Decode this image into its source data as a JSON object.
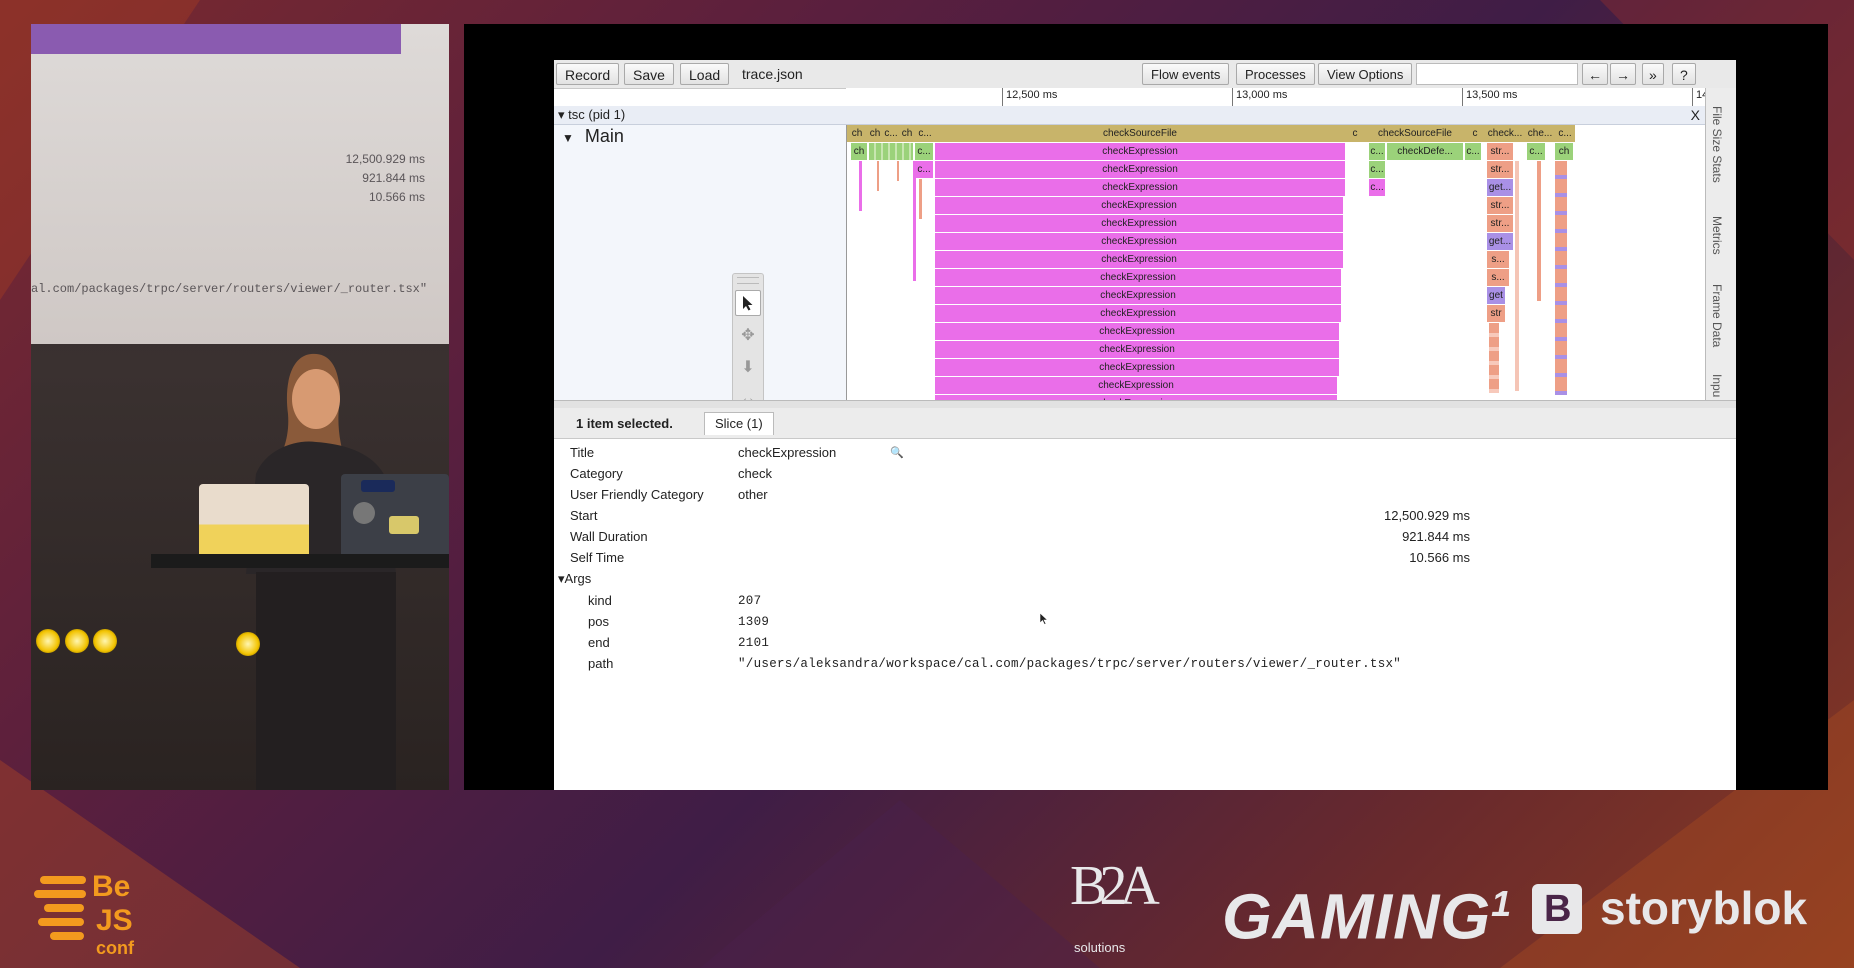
{
  "projection": {
    "values": [
      "12,500.929 ms",
      "921.844 ms",
      "10.566 ms"
    ],
    "path_fragment": "al.com/packages/trpc/server/routers/viewer/_router.tsx\""
  },
  "toolbar": {
    "record": "Record",
    "save": "Save",
    "load": "Load",
    "filename": "trace.json",
    "flow_events": "Flow events",
    "processes": "Processes",
    "view_options": "View Options",
    "prev": "←",
    "next": "→",
    "more": "»",
    "help": "?"
  },
  "ruler": {
    "ticks": [
      "12,500 ms",
      "13,000 ms",
      "13,500 ms",
      "14"
    ]
  },
  "process": {
    "label": "▾ tsc (pid 1)",
    "close": "X"
  },
  "thread": {
    "label": "Main"
  },
  "flame": {
    "top_labels": [
      "ch",
      "ch",
      "c...",
      "ch",
      "c...",
      "checkSourceFile",
      "c",
      "checkSourceFile",
      "c",
      "check...",
      "che...",
      "c..."
    ],
    "row2_labels": [
      "ch",
      "c...",
      "checkExpression",
      "c...",
      "checkDefe...",
      "c...",
      "str...",
      "c...",
      "ch"
    ],
    "stack_label": "checkExpression",
    "right_labels": [
      "str...",
      "get...",
      "str...",
      "str...",
      "get...",
      "s...",
      "s...",
      "get",
      "str"
    ],
    "colors": {
      "checkSourceFile": "#c8b46a",
      "checkExpression": "#ea6ee9",
      "green": "#9bd27a",
      "salmon": "#ee9f86",
      "purple": "#a990e6"
    }
  },
  "side_tabs": [
    "File Size Stats",
    "Metrics",
    "Frame Data",
    "Inpu"
  ],
  "panel": {
    "selection": "1 item selected.",
    "tab": "Slice (1)"
  },
  "details": {
    "title_key": "Title",
    "title_val": "checkExpression",
    "category_key": "Category",
    "category_val": "check",
    "ufc_key": "User Friendly Category",
    "ufc_val": "other",
    "start_key": "Start",
    "start_val": "12,500.929 ms",
    "wall_key": "Wall Duration",
    "wall_val": "921.844 ms",
    "self_key": "Self Time",
    "self_val": "10.566 ms",
    "args_key": "▾Args",
    "args": [
      {
        "k": "kind",
        "v": "207"
      },
      {
        "k": "pos",
        "v": "1309"
      },
      {
        "k": "end",
        "v": "2101"
      },
      {
        "k": "path",
        "v": "\"/users/aleksandra/workspace/cal.com/packages/trpc/server/routers/viewer/_router.tsx\""
      }
    ]
  },
  "sponsors": {
    "bejs_line1": "Be",
    "bejs_line2": "JS",
    "bejs_line3": "conf",
    "b2a_mark": "B2A",
    "b2a_sub": "solutions",
    "gaming": "GAMING",
    "gaming_sup": "1",
    "storyblok_mark": "B",
    "storyblok": "storyblok"
  }
}
